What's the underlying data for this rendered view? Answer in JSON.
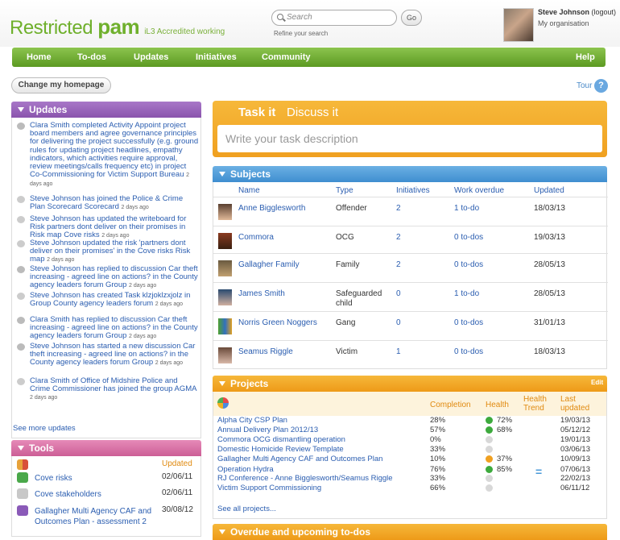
{
  "header": {
    "logo_main": "Restricted",
    "logo_bold": "pam",
    "logo_tag": "iL3 Accredited working",
    "search_placeholder": "Search",
    "go_label": "Go",
    "refine_label": "Refine your search",
    "user_name": "Steve Johnson",
    "logout_label": "(logout)",
    "organisation": "My organisation"
  },
  "nav": [
    "Home",
    "To-dos",
    "Updates",
    "Initiatives",
    "Community",
    "Help"
  ],
  "change_homepage": "Change my homepage",
  "tour": "Tour",
  "updates": {
    "title": "Updates",
    "see_more": "See more updates",
    "items": [
      {
        "text": "Clara Smith completed Activity Appoint project board members and agree governance principles for delivering the project successfully (e.g. ground rules for updating project headlines, empathy indicators, which activities require approval, review meetings/calls frequency etc) in project Co-Commissioning for Victim Support Bureau",
        "when": "2 days ago"
      },
      {
        "text": "Steve Johnson has joined the Police & Crime Plan Scorecard Scorecard",
        "when": "2 days ago"
      },
      {
        "text": "Steve Johnson has updated the writeboard for Risk partners dont deliver on their promises in Risk map Cove risks",
        "when": "2 days ago"
      },
      {
        "text": "Steve Johnson updated the risk 'partners dont deliver on their promises' in the Cove risks Risk map",
        "when": "2 days ago"
      },
      {
        "text": "Steve Johnson has replied to discussion Car theft increasing - agreed line on actions? in the County agency leaders forum Group",
        "when": "2 days ago"
      },
      {
        "text": "Steve Johnson has created Task klzjoklzxjolz in Group County agency leaders forum",
        "when": "2 days ago"
      },
      {
        "text": "Clara Smith has replied to discussion Car theft increasing - agreed line on actions? in the County agency leaders forum Group",
        "when": "2 days ago"
      },
      {
        "text": "Steve Johnson has started a new discussion Car theft increasing - agreed line on actions? in the County agency leaders forum Group",
        "when": "2 days ago"
      },
      {
        "text": "Clara Smith of Office of Midshire Police and Crime Commissioner has joined the group AGMA",
        "when": "2 days ago"
      }
    ]
  },
  "tools": {
    "title": "Tools",
    "updated_header": "Updated",
    "items": [
      {
        "name": "Cove risks",
        "date": "02/06/11"
      },
      {
        "name": "Cove stakeholders",
        "date": "02/06/11"
      },
      {
        "name": "Gallagher Multi Agency CAF and Outcomes Plan - assessment 2",
        "date": "30/08/12"
      }
    ]
  },
  "task": {
    "tab_task": "Task it",
    "tab_discuss": "Discuss it",
    "placeholder": "Write your task description"
  },
  "subjects": {
    "title": "Subjects",
    "headers": [
      "Name",
      "Type",
      "Initiatives",
      "Work overdue",
      "Updated"
    ],
    "rows": [
      {
        "name": "Anne Bigglesworth",
        "type": "Offender",
        "initiatives": "2",
        "overdue": "1 to-do",
        "updated": "18/03/13"
      },
      {
        "name": "Commora",
        "type": "OCG",
        "initiatives": "2",
        "overdue": "0 to-dos",
        "updated": "19/03/13"
      },
      {
        "name": "Gallagher Family",
        "type": "Family",
        "initiatives": "2",
        "overdue": "0 to-dos",
        "updated": "28/05/13"
      },
      {
        "name": "James Smith",
        "type": "Safeguarded child",
        "initiatives": "0",
        "overdue": "1 to-do",
        "updated": "28/05/13"
      },
      {
        "name": "Norris Green Noggers",
        "type": "Gang",
        "initiatives": "0",
        "overdue": "0 to-dos",
        "updated": "31/01/13"
      },
      {
        "name": "Seamus Riggle",
        "type": "Victim",
        "initiatives": "1",
        "overdue": "0 to-dos",
        "updated": "18/03/13"
      }
    ]
  },
  "projects": {
    "title": "Projects",
    "edit": "Edit",
    "headers": {
      "completion": "Completion",
      "health": "Health",
      "trend": "Health Trend",
      "updated": "Last updated"
    },
    "see_all": "See all projects...",
    "rows": [
      {
        "name": "Alpha City CSP Plan",
        "completion": "28%",
        "health": "72%",
        "health_color": "#3daa3d",
        "trend": "",
        "updated": "19/03/13"
      },
      {
        "name": "Annual Delivery Plan 2012/13",
        "completion": "57%",
        "health": "68%",
        "health_color": "#3daa3d",
        "trend": "",
        "updated": "05/12/12"
      },
      {
        "name": "Commora OCG dismantling operation",
        "completion": "0%",
        "health": "",
        "health_color": "#d8d8d8",
        "trend": "",
        "updated": "19/01/13"
      },
      {
        "name": "Domestic Homicide Review Template",
        "completion": "33%",
        "health": "",
        "health_color": "#d8d8d8",
        "trend": "",
        "updated": "03/06/13"
      },
      {
        "name": "Gallagher Multi Agency CAF and Outcomes Plan",
        "completion": "10%",
        "health": "37%",
        "health_color": "#f0a020",
        "trend": "",
        "updated": "10/09/13"
      },
      {
        "name": "Operation Hydra",
        "completion": "76%",
        "health": "85%",
        "health_color": "#3daa3d",
        "trend": "=",
        "updated": "07/06/13"
      },
      {
        "name": "RJ Conference - Anne Bigglesworth/Seamus Riggle",
        "completion": "33%",
        "health": "",
        "health_color": "#d8d8d8",
        "trend": "",
        "updated": "22/02/13"
      },
      {
        "name": "Victim Support Commissioning",
        "completion": "66%",
        "health": "",
        "health_color": "#d8d8d8",
        "trend": "",
        "updated": "06/11/12"
      }
    ]
  },
  "overdue": {
    "title": "Overdue and upcoming to-dos"
  }
}
